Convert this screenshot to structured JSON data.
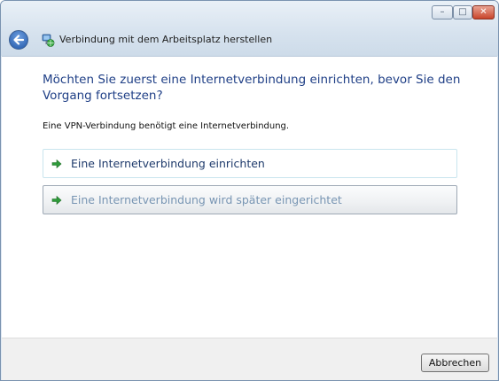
{
  "window": {
    "title": "Verbindung mit dem Arbeitsplatz herstellen",
    "controls": {
      "minimize": "–",
      "maximize": "□",
      "close": "✕"
    }
  },
  "main": {
    "heading": "Möchten Sie zuerst eine Internetverbindung einrichten, bevor Sie den Vorgang fortsetzen?",
    "description": "Eine VPN-Verbindung benötigt eine Internetverbindung.",
    "options": [
      {
        "label": "Eine Internetverbindung einrichten",
        "icon": "green-arrow-icon"
      },
      {
        "label": "Eine Internetverbindung wird später eingerichtet",
        "icon": "green-arrow-icon"
      }
    ]
  },
  "footer": {
    "cancel_label": "Abbrechen"
  },
  "colors": {
    "heading": "#1f3f86",
    "arrow": "#2e9b3a",
    "close": "#c9452b"
  }
}
